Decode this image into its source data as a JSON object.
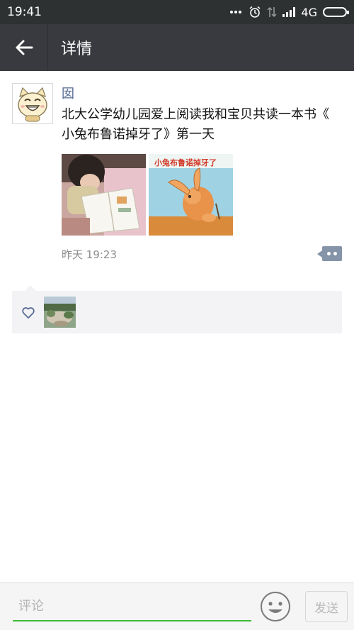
{
  "status_bar": {
    "time": "19:41",
    "network": "4G"
  },
  "header": {
    "title": "详情",
    "back_icon": "arrow-left-icon"
  },
  "post": {
    "user_name": "囡",
    "text": "北大公学幼儿园爱上阅读我和宝贝共读一本书《 小兔布鲁诺掉牙了》第一天",
    "book_cover_title": "小兔布鲁诺掉牙了",
    "timestamp": "昨天 19:23",
    "comment_icon": "more-dots-icon"
  },
  "likes": {
    "icon": "heart-icon"
  },
  "input_bar": {
    "placeholder": "评论",
    "send_label": "发送",
    "emoji_icon": "smiley-icon"
  },
  "colors": {
    "header_bg": "#393a3f",
    "status_bg": "#2e3132",
    "link": "#576b95",
    "accent_green": "#3fb838"
  }
}
